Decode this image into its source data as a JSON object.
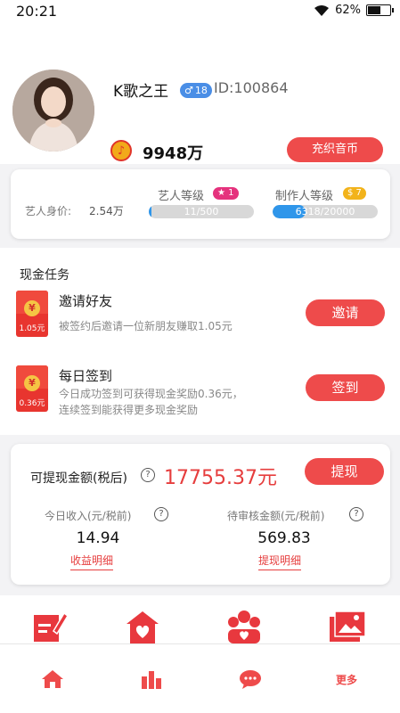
{
  "status_bar": {
    "time": "20:21",
    "battery": "62%",
    "battery_level": 0.62
  },
  "profile": {
    "username": "K歌之王",
    "level": "18",
    "gender_symbol": "♂",
    "user_id": "ID:100864",
    "coins": "9948万",
    "recharge_label": "充织音币"
  },
  "stats": {
    "worth_label": "艺人身价:",
    "worth_value": "2.54万",
    "artist": {
      "title": "艺人等级",
      "level": "1",
      "progress_text": "11/500",
      "progress": 0.022
    },
    "producer": {
      "title": "制作人等级",
      "level": "7",
      "progress_text": "6318/20000",
      "progress": 0.316
    }
  },
  "tasks": {
    "section_title": "现金任务",
    "items": [
      {
        "title": "邀请好友",
        "desc_line1": "被签约后邀请一位新朋友赚取1.05元",
        "desc_line2": "",
        "reward": "1.05元",
        "button": "邀请"
      },
      {
        "title": "每日签到",
        "desc_line1": "今日成功签到可获得现金奖励0.36元，",
        "desc_line2": "连续签到能获得更多现金奖励",
        "reward": "0.36元",
        "button": "签到"
      }
    ]
  },
  "withdraw": {
    "label": "可提现金额(税后)",
    "amount": "17755.37元",
    "button": "提现",
    "today_label": "今日收入(元/税前)",
    "today_value": "14.94",
    "today_link": "收益明细",
    "pending_label": "待审核金额(元/税前)",
    "pending_value": "569.83",
    "pending_link": "提现明细"
  },
  "quick_icons": [
    "edit-icon",
    "house-heart-icon",
    "people-heart-icon",
    "gallery-icon"
  ],
  "tabbar": {
    "more_label": "更多",
    "tabs": [
      "home-icon",
      "chart-icon",
      "chat-icon"
    ]
  },
  "colors": {
    "accent": "#ee4b4b",
    "blue": "#2f96ea"
  }
}
